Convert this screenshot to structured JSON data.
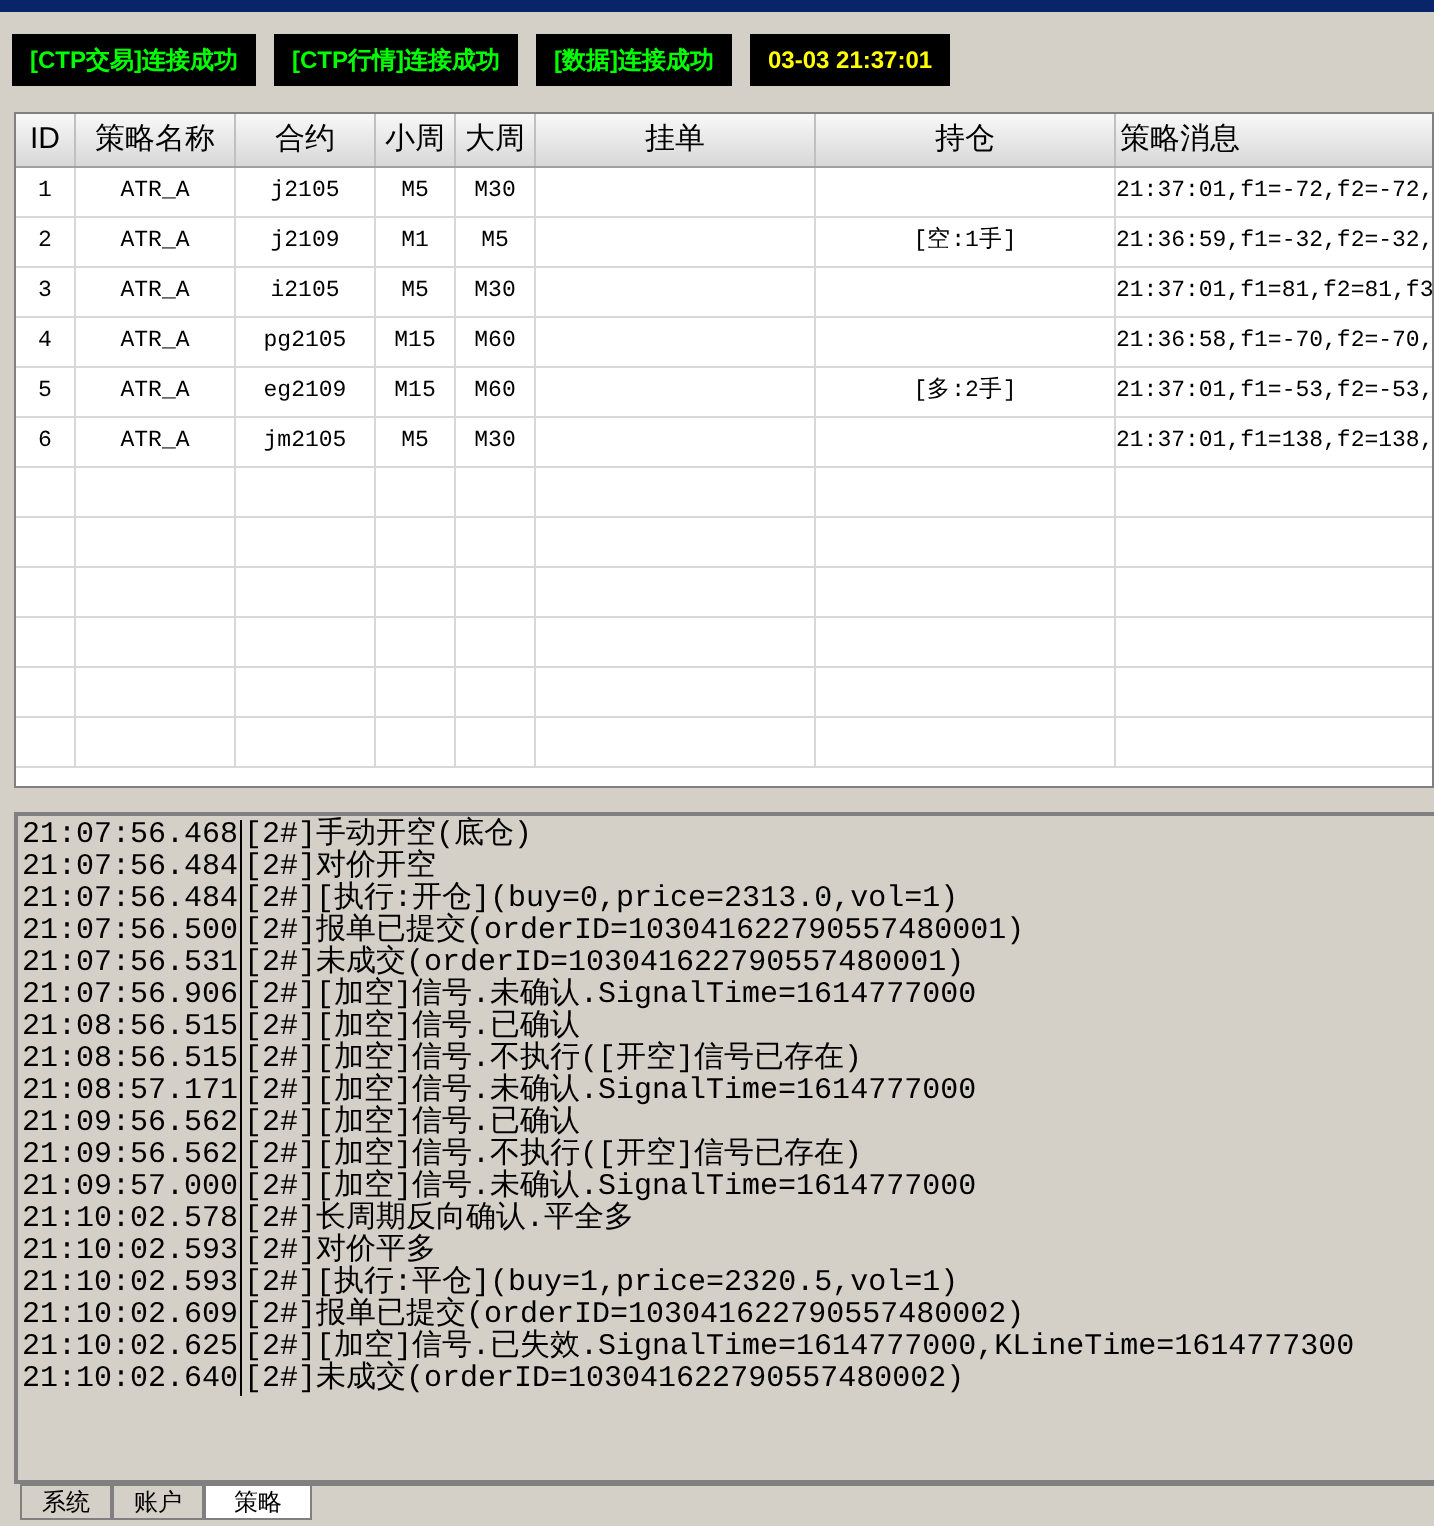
{
  "status_bar": [
    {
      "kind": "status",
      "text": "[CTP交易]连接成功"
    },
    {
      "kind": "status",
      "text": "[CTP行情]连接成功"
    },
    {
      "kind": "status",
      "text": "[数据]连接成功"
    },
    {
      "kind": "clock",
      "text": "03-03 21:37:01"
    }
  ],
  "table": {
    "columns": [
      "ID",
      "策略名称",
      "合约",
      "小周",
      "大周",
      "挂单",
      "持仓",
      "策略消息"
    ],
    "rows": [
      {
        "id": "1",
        "strategy": "ATR_A",
        "contract": "j2105",
        "small_period": "M5",
        "large_period": "M30",
        "message": "21:37:01,f1=-72,f2=-72,"
      },
      {
        "id": "2",
        "strategy": "ATR_A",
        "contract": "j2109",
        "small_period": "M1",
        "large_period": "M5",
        "position": "[空:1手]",
        "message": "21:36:59,f1=-32,f2=-32,"
      },
      {
        "id": "3",
        "strategy": "ATR_A",
        "contract": "i2105",
        "small_period": "M5",
        "large_period": "M30",
        "message": "21:37:01,f1=81,f2=81,f3"
      },
      {
        "id": "4",
        "strategy": "ATR_A",
        "contract": "pg2105",
        "small_period": "M15",
        "large_period": "M60",
        "message": "21:36:58,f1=-70,f2=-70,"
      },
      {
        "id": "5",
        "strategy": "ATR_A",
        "contract": "eg2109",
        "small_period": "M15",
        "large_period": "M60",
        "position": "[多:2手]",
        "message": "21:37:01,f1=-53,f2=-53,"
      },
      {
        "id": "6",
        "strategy": "ATR_A",
        "contract": "jm2105",
        "small_period": "M5",
        "large_period": "M30",
        "message": "21:37:01,f1=138,f2=138,"
      }
    ]
  },
  "log": [
    {
      "time": "21:07:56.468",
      "text": "[2#]手动开空(底仓)"
    },
    {
      "time": "21:07:56.484",
      "text": "[2#]对价开空"
    },
    {
      "time": "21:07:56.484",
      "text": "[2#][执行:开仓](buy=0,price=2313.0,vol=1)"
    },
    {
      "time": "21:07:56.500",
      "text": "[2#]报单已提交(orderID=103041622790557480001)"
    },
    {
      "time": "21:07:56.531",
      "text": "[2#]未成交(orderID=103041622790557480001)"
    },
    {
      "time": "21:07:56.906",
      "text": "[2#][加空]信号.未确认.SignalTime=1614777000"
    },
    {
      "time": "21:08:56.515",
      "text": "[2#][加空]信号.已确认"
    },
    {
      "time": "21:08:56.515",
      "text": "[2#][加空]信号.不执行([开空]信号已存在)"
    },
    {
      "time": "21:08:57.171",
      "text": "[2#][加空]信号.未确认.SignalTime=1614777000"
    },
    {
      "time": "21:09:56.562",
      "text": "[2#][加空]信号.已确认"
    },
    {
      "time": "21:09:56.562",
      "text": "[2#][加空]信号.不执行([开空]信号已存在)"
    },
    {
      "time": "21:09:57.000",
      "text": "[2#][加空]信号.未确认.SignalTime=1614777000"
    },
    {
      "time": "21:10:02.578",
      "text": "[2#]长周期反向确认.平全多"
    },
    {
      "time": "21:10:02.593",
      "text": "[2#]对价平多"
    },
    {
      "time": "21:10:02.593",
      "text": "[2#][执行:平仓](buy=1,price=2320.5,vol=1)"
    },
    {
      "time": "21:10:02.609",
      "text": "[2#]报单已提交(orderID=103041622790557480002)"
    },
    {
      "time": "21:10:02.625",
      "text": "[2#][加空]信号.已失效.SignalTime=1614777000,KLineTime=1614777300"
    },
    {
      "time": "21:10:02.640",
      "text": "[2#]未成交(orderID=103041622790557480002)"
    }
  ],
  "tabs": [
    {
      "label": "系统",
      "selected": false
    },
    {
      "label": "账户",
      "selected": false
    },
    {
      "label": "策略",
      "selected": true
    }
  ]
}
